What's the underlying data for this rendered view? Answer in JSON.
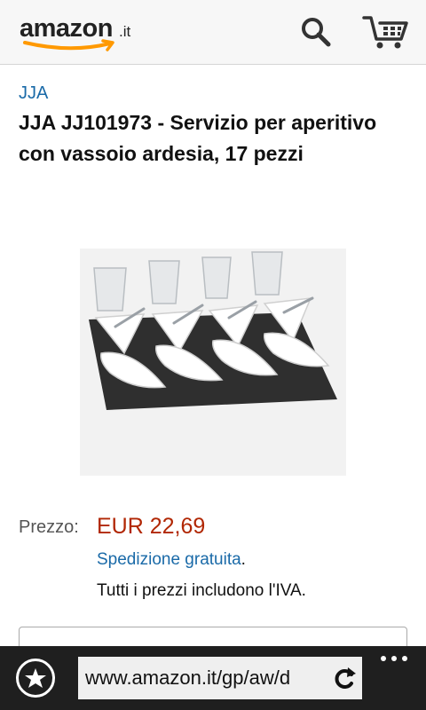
{
  "header": {
    "logo_word": "amazon",
    "logo_tld": ".it",
    "search_icon": "search-icon",
    "cart_icon": "cart-icon",
    "brand_color": "#ff9900"
  },
  "product": {
    "brand": "JJA",
    "title": "JJA JJ101973 - Servizio per aperitivo con vassoio ardesia, 17 pezzi",
    "image_alt": "product-image"
  },
  "pricing": {
    "price_label": "Prezzo:",
    "price_value": "EUR 22,69",
    "price_color": "#b12704",
    "shipping_link": "Spedizione gratuita",
    "shipping_suffix": ".",
    "vat_note": "Tutti i prezzi includono l'IVA."
  },
  "browser": {
    "url": "www.amazon.it/gp/aw/d",
    "favorites_icon": "star-icon",
    "refresh_icon": "refresh-icon",
    "more_icon": "more-icon"
  }
}
